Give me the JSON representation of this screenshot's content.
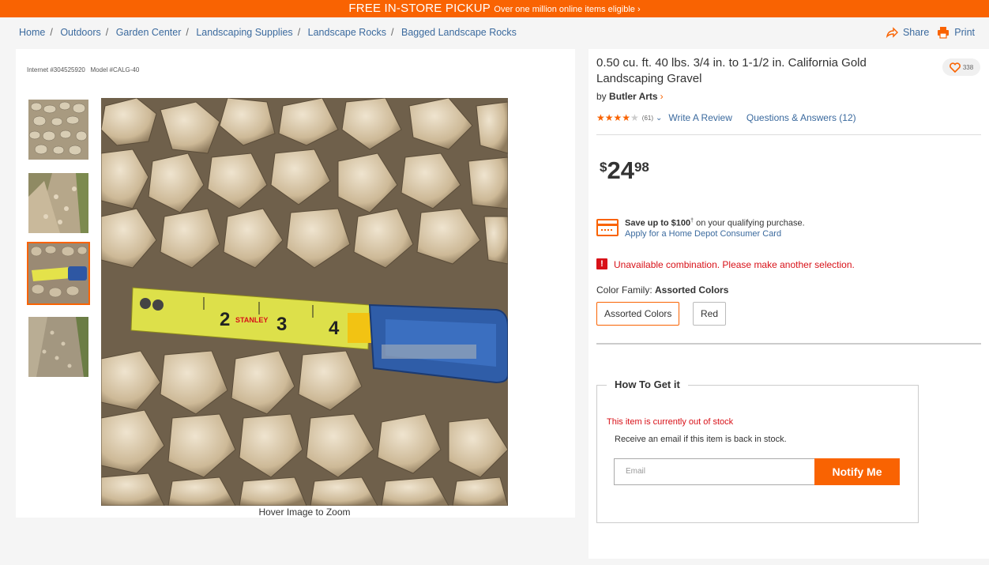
{
  "promo": {
    "headline": "FREE IN-STORE PICKUP",
    "detail": "Over one million online items eligible ›"
  },
  "breadcrumb": [
    {
      "label": "Home"
    },
    {
      "label": "Outdoors"
    },
    {
      "label": "Garden Center"
    },
    {
      "label": "Landscaping Supplies"
    },
    {
      "label": "Landscape Rocks"
    },
    {
      "label": "Bagged Landscape Rocks"
    }
  ],
  "actions": {
    "share": "Share",
    "print": "Print",
    "share_icon": "share-arrow-icon",
    "print_icon": "printer-icon"
  },
  "product": {
    "internet_no": "Internet #304525920",
    "model_no": "Model #CALG-40",
    "title": "0.50 cu. ft. 40 lbs. 3/4 in. to 1-1/2 in. California Gold Landscaping Gravel",
    "by": "by",
    "brand": "Butler Arts",
    "favorites": "338",
    "rating_stars": 4,
    "rating_count": "(61)",
    "write_review": "Write A Review",
    "qa": "Questions & Answers (12)",
    "price_symbol": "$",
    "price_dollars": "24",
    "price_cents": "98",
    "card_offer_bold": "Save up to $100",
    "card_offer_sup": "†",
    "card_offer_rest": " on your qualifying purchase.",
    "card_apply": "Apply for a Home Depot Consumer Card",
    "alert": "Unavailable combination. Please make another selection.",
    "color_family_label": "Color Family: ",
    "color_family_value": "Assorted Colors",
    "color_options": [
      "Assorted Colors",
      "Red"
    ],
    "hover_zoom": "Hover Image to Zoom"
  },
  "get_it": {
    "title": "How To Get it",
    "out_of_stock": "This item is currently out of stock",
    "notify_text": "Receive an email if this item is back in stock.",
    "email_placeholder": "Email",
    "notify_button": "Notify Me"
  },
  "colors": {
    "accent": "#f96302",
    "link": "#3b6a9e",
    "alert": "#d81118"
  }
}
